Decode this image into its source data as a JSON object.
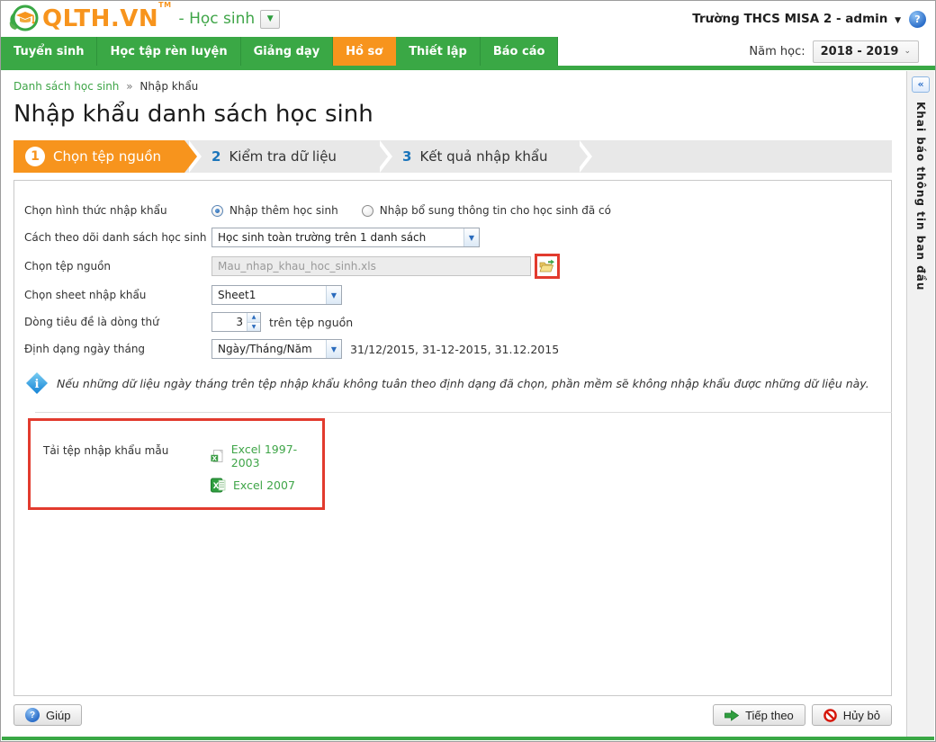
{
  "header": {
    "logo_text": "QLTH.VN",
    "logo_tm": "TM",
    "module": "- Học sinh",
    "account": "Trường THCS MISA 2 - admin",
    "account_caret": "▼",
    "help_glyph": "?",
    "year_label": "Năm học:",
    "year_value": "2018 - 2019",
    "year_chevron": "⌄",
    "module_chevron": "▼"
  },
  "nav": {
    "tabs": [
      {
        "label": "Tuyển sinh",
        "active": false
      },
      {
        "label": "Học tập rèn luyện",
        "active": false
      },
      {
        "label": "Giảng dạy",
        "active": false
      },
      {
        "label": "Hồ sơ",
        "active": true
      },
      {
        "label": "Thiết lập",
        "active": false
      },
      {
        "label": "Báo cáo",
        "active": false
      }
    ]
  },
  "breadcrumb": {
    "parent": "Danh sách học sinh",
    "separator": "»",
    "current": "Nhập khẩu"
  },
  "page_title": "Nhập khẩu danh sách học sinh",
  "wizard": {
    "steps": [
      {
        "num": "1",
        "label": "Chọn tệp nguồn",
        "active": true
      },
      {
        "num": "2",
        "label": "Kiểm tra dữ liệu",
        "active": false
      },
      {
        "num": "3",
        "label": "Kết quả nhập khẩu",
        "active": false
      }
    ]
  },
  "form": {
    "import_type": {
      "label": "Chọn hình thức nhập khẩu",
      "options": [
        {
          "label": "Nhập thêm học sinh",
          "selected": true
        },
        {
          "label": "Nhập bổ sung thông tin cho học sinh đã có",
          "selected": false
        }
      ]
    },
    "track_method": {
      "label": "Cách theo dõi danh sách học sinh",
      "value": "Học sinh toàn trường trên 1 danh sách"
    },
    "source_file": {
      "label": "Chọn tệp nguồn",
      "value": "Mau_nhap_khau_hoc_sinh.xls"
    },
    "sheet": {
      "label": "Chọn sheet nhập khẩu",
      "value": "Sheet1"
    },
    "header_row": {
      "label": "Dòng tiêu đề là dòng thứ",
      "value": "3",
      "suffix": "trên tệp nguồn"
    },
    "date_format": {
      "label": "Định dạng ngày tháng",
      "value": "Ngày/Tháng/Năm",
      "examples": "31/12/2015, 31-12-2015, 31.12.2015"
    },
    "note": "Nếu những dữ liệu ngày tháng trên tệp nhập khẩu không tuân theo định dạng đã chọn, phần mềm sẽ không nhập khẩu được những dữ liệu này."
  },
  "download": {
    "label": "Tải tệp nhập khẩu mẫu",
    "links": [
      {
        "label": "Excel 1997-2003"
      },
      {
        "label": "Excel 2007"
      }
    ]
  },
  "sidebar": {
    "collapse_glyph": "«",
    "title": "Khai báo thông tin ban đầu"
  },
  "footer": {
    "help": "Giúp",
    "next": "Tiếp theo",
    "cancel": "Hủy bỏ"
  },
  "colors": {
    "brand_orange": "#f7941d",
    "brand_green": "#3aa845",
    "link_green": "#3fa548",
    "step_number_blue": "#1b75bb",
    "highlight_red": "#e23b2e"
  }
}
